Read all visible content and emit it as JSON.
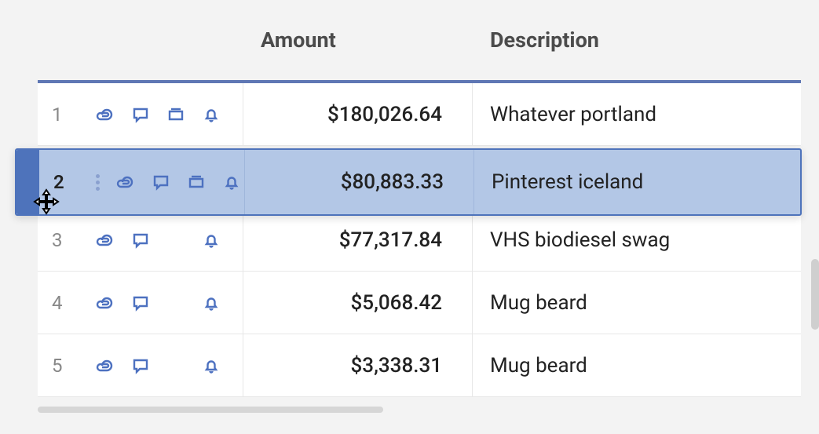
{
  "headers": {
    "amount": "Amount",
    "description": "Description"
  },
  "rows": [
    {
      "num": "1",
      "amount": "$180,026.64",
      "description": "Whatever portland",
      "icons": [
        "attachment",
        "comment",
        "archive",
        "bell"
      ]
    },
    {
      "num": "2",
      "amount": "$80,883.33",
      "description": "Pinterest iceland",
      "icons": [
        "attachment",
        "comment",
        "archive",
        "bell"
      ],
      "selected": true
    },
    {
      "num": "3",
      "amount": "$77,317.84",
      "description": "VHS biodiesel swag",
      "icons": [
        "attachment",
        "comment",
        "bell"
      ]
    },
    {
      "num": "4",
      "amount": "$5,068.42",
      "description": "Mug beard",
      "icons": [
        "attachment",
        "comment",
        "bell"
      ]
    },
    {
      "num": "5",
      "amount": "$3,338.31",
      "description": "Mug beard",
      "icons": [
        "attachment",
        "comment",
        "bell"
      ]
    }
  ]
}
